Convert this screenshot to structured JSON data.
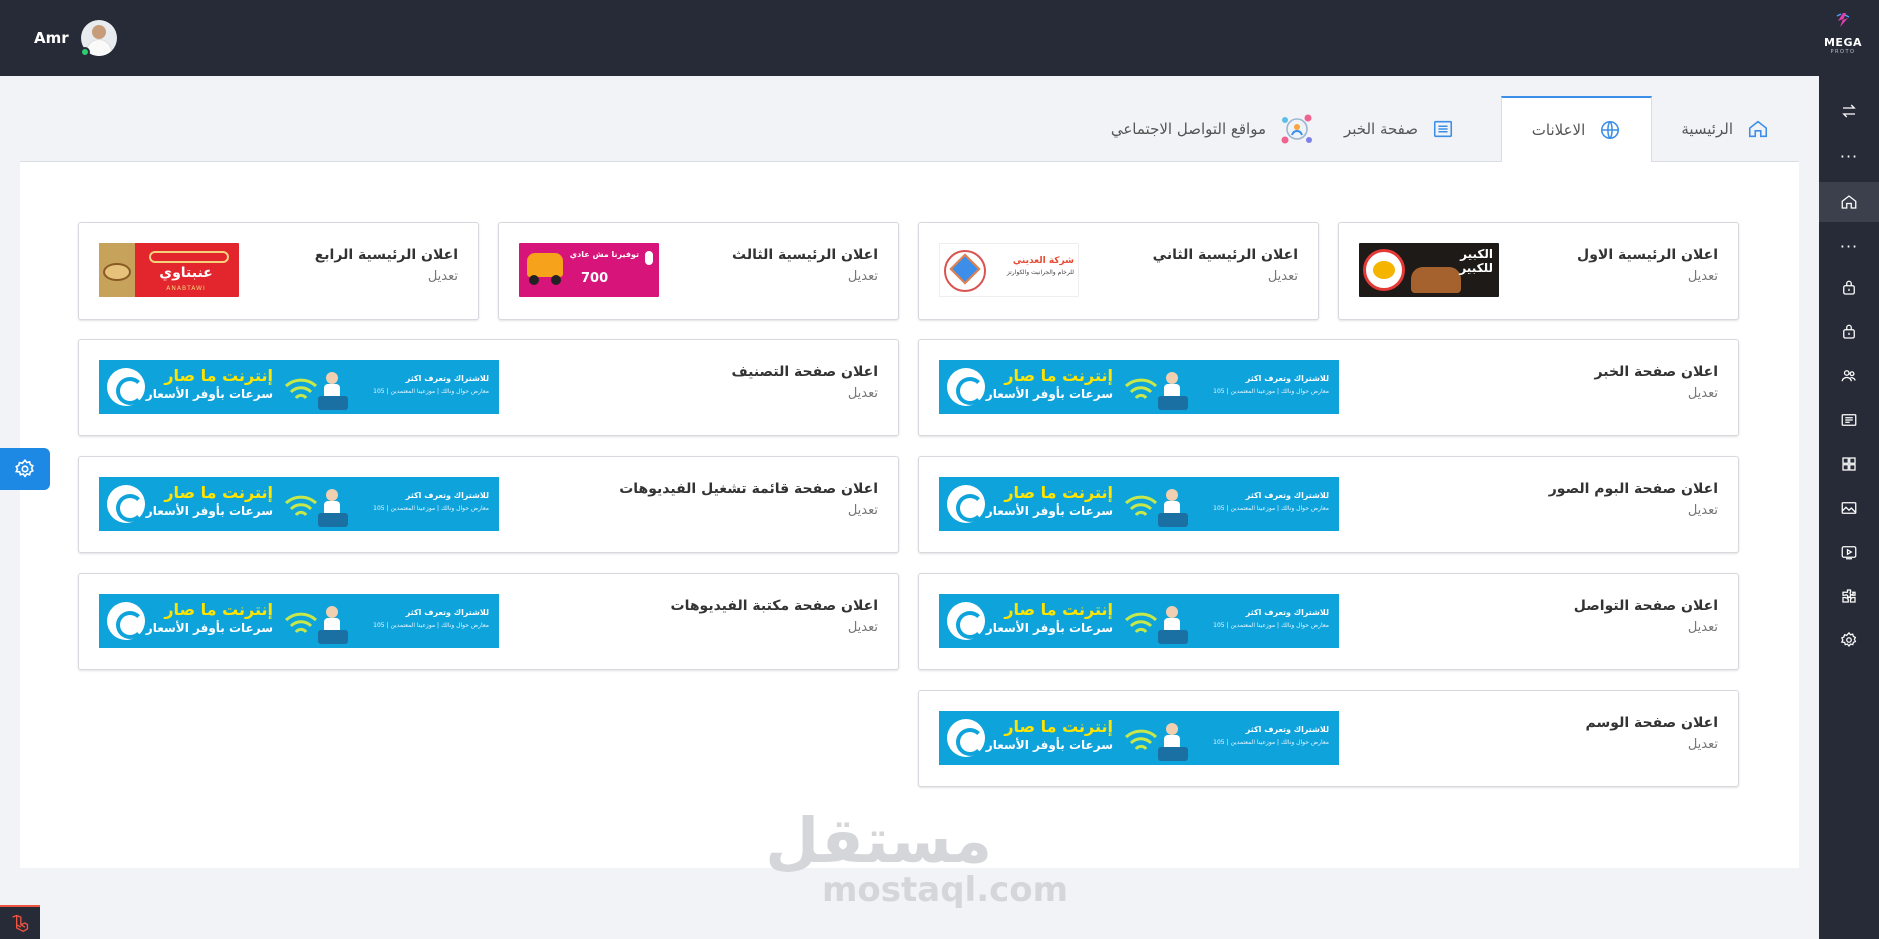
{
  "header": {
    "user_name": "Amr",
    "logo_text": "MEGA",
    "logo_subtext": "PROTO"
  },
  "tabs": [
    {
      "label": "الرئيسية",
      "icon": "home-icon",
      "active": false
    },
    {
      "label": "الاعلانات",
      "icon": "globe-icon",
      "active": true
    },
    {
      "label": "صفحة الخبر",
      "icon": "list-icon",
      "active": false
    },
    {
      "label": "مواقع التواصل الاجتماعي",
      "icon": "social-network-icon",
      "active": false
    }
  ],
  "cards": [
    {
      "title": "اعلان الرئيسية الاول",
      "edit": "تعديل",
      "thumb": "burger-ad",
      "thumb_text": "الكبير للكبير"
    },
    {
      "title": "اعلان الرئيسية الثاني",
      "edit": "تعديل",
      "thumb": "marble-company-ad",
      "thumb_text": "شركة العديني",
      "thumb_subtext": "للرخام والجرانيت والكوارتز"
    },
    {
      "title": "اعلان الرئيسية الثالث",
      "edit": "تعديل",
      "thumb": "tuk-tuk-ad",
      "thumb_text": "توفيرنا مش عادي",
      "thumb_value": "700"
    },
    {
      "title": "اعلان الرئيسية الرابع",
      "edit": "تعديل",
      "thumb": "anabtawi-sweets-ad",
      "thumb_text": "عنبتاوي",
      "thumb_subtext": "ANABTAWI"
    },
    {
      "title": "اعلان صفحة الخبر",
      "edit": "تعديل"
    },
    {
      "title": "اعلان صفحة التصنيف",
      "edit": "تعديل"
    },
    {
      "title": "اعلان صفحة البوم الصور",
      "edit": "تعديل"
    },
    {
      "title": "اعلان صفحة قائمة تشغيل الفيديوهات",
      "edit": "تعديل"
    },
    {
      "title": "اعلان صفحة التواصل",
      "edit": "تعديل"
    },
    {
      "title": "اعلان صفحة مكتبة الفيديوهات",
      "edit": "تعديل"
    },
    {
      "title": "اعلان صفحة الوسم",
      "edit": "تعديل"
    }
  ],
  "banner": {
    "headline": "إنترنت ما صار",
    "subline": "سرعات بأوفر الأسعار",
    "side_title": "للاشتراك وتعرف اكثر",
    "side_text": "معارض حوال ونالك | موزعينا المعتمدين | 105"
  },
  "sidebar": {
    "icons": [
      "swap-arrows-icon",
      "more-dots-icon",
      "home-icon",
      "more-dots-icon",
      "lock-bag-icon",
      "lock-bag-icon",
      "users-icon",
      "newspaper-icon",
      "grid-icon",
      "image-icon",
      "video-icon",
      "puzzle-icon",
      "settings-gear-icon"
    ]
  },
  "watermark": {
    "arabic": "مستقل",
    "latin": "mostaql.com"
  },
  "colors": {
    "topbar": "#262b37",
    "accent": "#3c8ee8",
    "banner_bg": "#0fa3dc",
    "banner_headline": "#ffe400"
  }
}
